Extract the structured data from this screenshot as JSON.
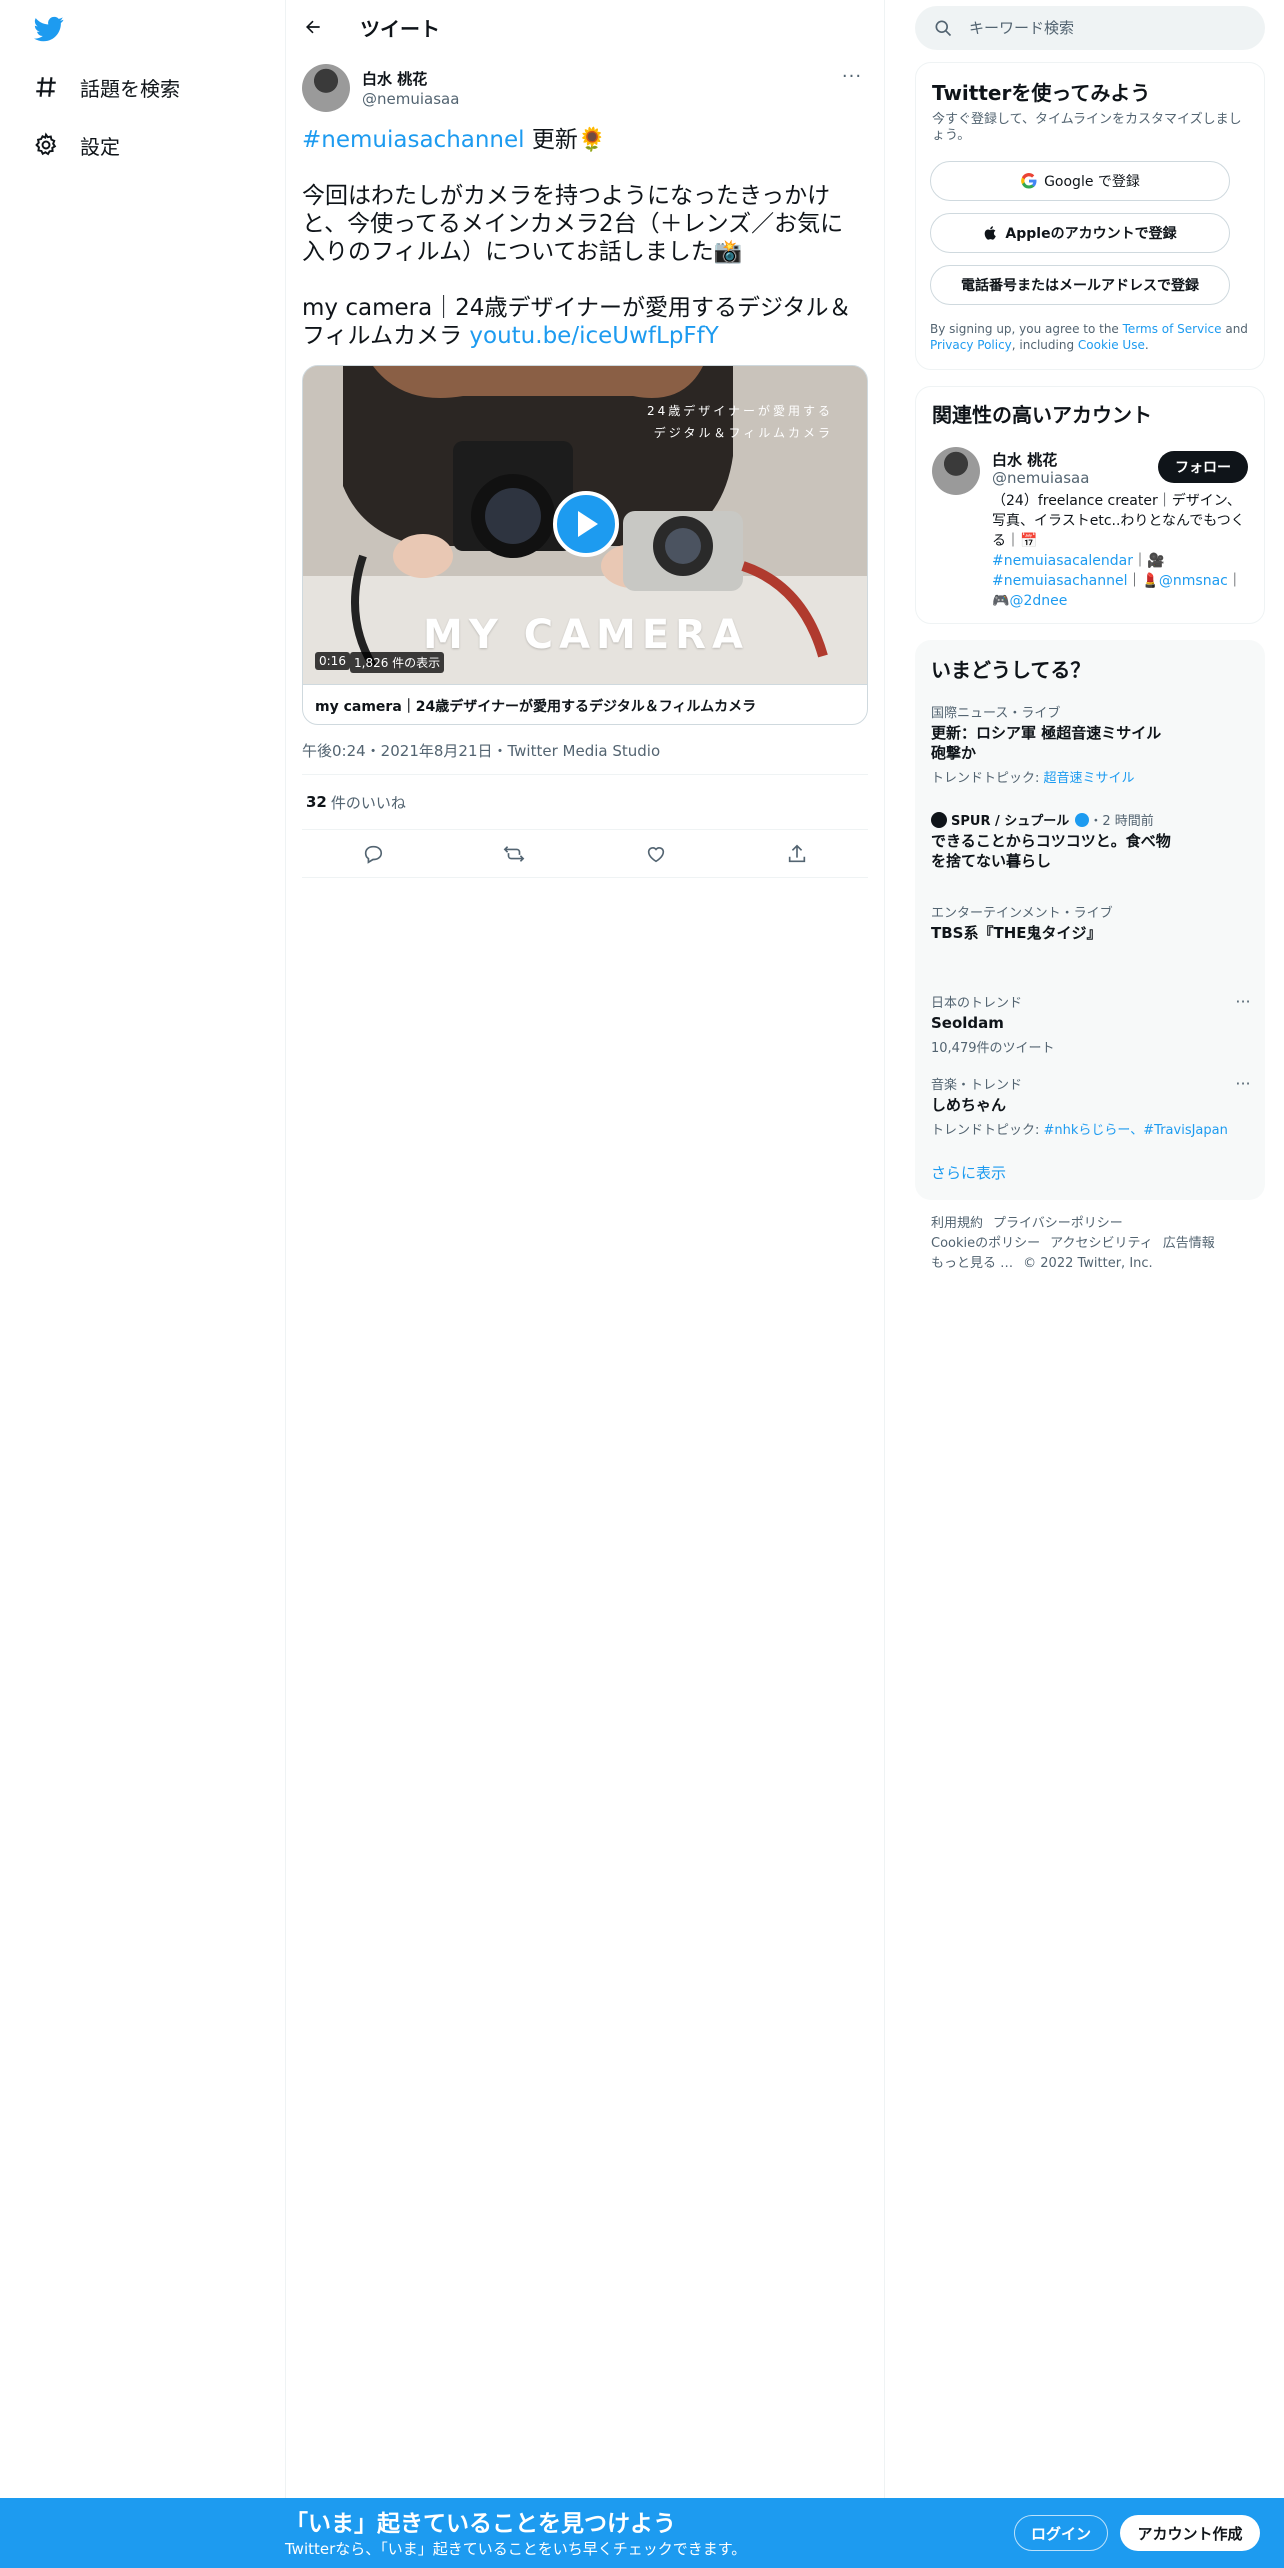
{
  "nav": {
    "logo_icon": "twitter-bird-icon",
    "explore_label": "話題を検索",
    "settings_label": "設定"
  },
  "header": {
    "title": "ツイート"
  },
  "tweet": {
    "author_name": "白水 桃花",
    "author_handle": "@nemuiasaa",
    "hashtag": "#nemuiasachannel",
    "line1_rest": " 更新🌻",
    "body": "今回はわたしがカメラを持つようになったきっかけと、今使ってるメインカメラ2台（＋レンズ／お気に入りのフィルム）についてお話しました📸",
    "video_title_text": "my camera｜24歳デザイナーが愛用するデジタル＆フィルムカメラ ",
    "link_text": "youtu.be/iceUwfLpFfY",
    "media": {
      "overlay_title": "MY CAMERA",
      "overlay_sub1": "24歳デザイナーが愛用する",
      "overlay_sub2": "デジタル＆フィルムカメラ",
      "duration": "0:16",
      "views": "1,826 件の表示",
      "caption": "my camera｜24歳デザイナーが愛用するデジタル＆フィルムカメラ"
    },
    "timestamp": "午後0:24・2021年8月21日・Twitter Media Studio",
    "likes_count": "32",
    "likes_label": "件のいいね"
  },
  "search": {
    "placeholder": "キーワード検索"
  },
  "signup": {
    "title": "Twitterを使ってみよう",
    "subtitle": "今すぐ登録して、タイムラインをカスタマイズしましょう。",
    "google_label": "Google で登録",
    "apple_label": "Appleのアカウントで登録",
    "phone_label": "電話番号またはメールアドレスで登録",
    "terms_prefix": "By signing up, you agree to the ",
    "terms_link": "Terms of Service",
    "terms_and": " and ",
    "privacy_link": "Privacy Policy",
    "terms_including": ", including ",
    "cookie_link": "Cookie Use",
    "terms_end": "."
  },
  "related": {
    "title": "関連性の高いアカウント",
    "name": "白水 桃花",
    "handle": "@nemuiasaa",
    "follow_label": "フォロー",
    "bio_text": "（24）freelance creater｜デザイン、写真、イラストetc..わりとなんでもつくる｜📅",
    "bio_tag1": "#nemuiasacalendar",
    "bio_sep1": "｜🎥",
    "bio_tag2": "#nemuiasachannel",
    "bio_sep2": "｜💄",
    "bio_mention1": "@nmsnac",
    "bio_sep3": "｜🎮",
    "bio_mention2": "@2dnee"
  },
  "trends": {
    "title": "いまどうしてる？",
    "items": [
      {
        "category": "国際ニュース・ライブ",
        "name": "更新：ロシア軍 極超音速ミサイル砲撃か",
        "extra_prefix": "トレンドトピック: ",
        "extra_link": "超音速ミサイル"
      },
      {
        "source": "SPUR / シュプール",
        "time": "・2 時間前",
        "name": "できることからコツコツと。食べ物を捨てない暮らし"
      },
      {
        "category": "エンターテインメント・ライブ",
        "name": "TBS系『THE鬼タイジ』"
      },
      {
        "category": "日本のトレンド",
        "name": "Seoldam",
        "extra": "10,479件のツイート"
      },
      {
        "category": "音楽・トレンド",
        "name": "しめちゃん",
        "extra_prefix": "トレンドトピック: ",
        "extra_link": "#nhkらじらー、#TravisJapan"
      }
    ],
    "show_more": "さらに表示"
  },
  "footer": {
    "terms": "利用規約",
    "privacy": "プライバシーポリシー",
    "cookie": "Cookieのポリシー",
    "accessibility": "アクセシビリティ",
    "ads": "広告情報",
    "more": "もっと見る …",
    "copyright": "© 2022 Twitter, Inc."
  },
  "bottom_bar": {
    "title": "「いま」起きていることを見つけよう",
    "subtitle": "Twitterなら、「いま」起きていることをいち早くチェックできます。",
    "login_label": "ログイン",
    "signup_label": "アカウント作成"
  },
  "colors": {
    "accent": "#1d9bf0",
    "text": "#0f1419",
    "muted": "#536471",
    "panel_bg": "#f7f9f9"
  }
}
